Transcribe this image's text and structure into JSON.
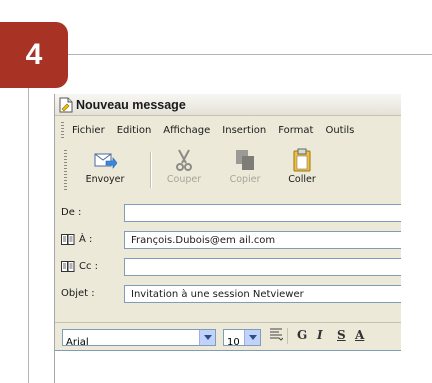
{
  "step": {
    "number": "4"
  },
  "window": {
    "title": "Nouveau message"
  },
  "menu": [
    "Fichier",
    "Edition",
    "Affichage",
    "Insertion",
    "Format",
    "Outils"
  ],
  "toolbar": {
    "send": "Envoyer",
    "cut": "Couper",
    "copy": "Copier",
    "paste": "Coller"
  },
  "headers": {
    "from_label": "De :",
    "from_value": "",
    "to_label": "À :",
    "to_value": "François.Dubois@em ail.com",
    "cc_label": "Cc :",
    "cc_value": "",
    "subject_label": "Objet :",
    "subject_value": "Invitation à une session Netviewer"
  },
  "format": {
    "font": "Arial",
    "size": "10",
    "bold": "G",
    "italic": "I",
    "underline": "S",
    "color": "A"
  },
  "colors": {
    "badge": "#a83224",
    "field_border": "#7f9db9",
    "window_bg": "#ece9d8"
  }
}
